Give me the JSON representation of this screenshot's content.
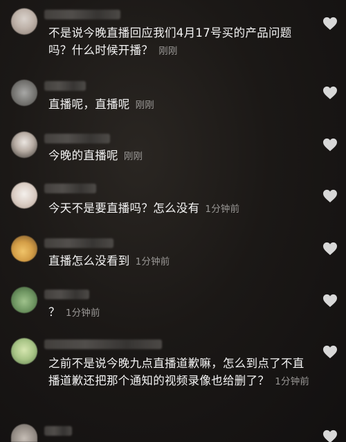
{
  "comments": [
    {
      "text": "不是说今晚直播回应我们4月17号买的产品问题吗？什么时候开播？",
      "time": "刚刚",
      "avatar_colors": [
        "#d9d2cc",
        "#8c7f76"
      ]
    },
    {
      "text": "直播呢，直播呢",
      "time": "刚刚",
      "avatar_colors": [
        "#9a9a98",
        "#55534f"
      ]
    },
    {
      "text": "今晚的直播呢",
      "time": "刚刚",
      "avatar_colors": [
        "#e8e4e0",
        "#3a3632"
      ]
    },
    {
      "text": "今天不是要直播吗？怎么没有",
      "time": "1分钟前",
      "avatar_colors": [
        "#f1ede9",
        "#c9b8ad"
      ]
    },
    {
      "text": "直播怎么没看到",
      "time": "1分钟前",
      "avatar_colors": [
        "#e7b653",
        "#a47a3a"
      ]
    },
    {
      "text": "？",
      "time": "1分钟前",
      "avatar_colors": [
        "#8fb27e",
        "#4a6b44"
      ]
    },
    {
      "text": "之前不是说今晚九点直播道歉嘛，怎么到点了不直播道歉还把那个通知的视频录像也给删了？",
      "time": "1分钟前",
      "avatar_colors": [
        "#cfe0a6",
        "#6f8f5a"
      ]
    },
    {
      "text": "",
      "time": "",
      "avatar_colors": [
        "#bfb7b0",
        "#7a746e"
      ]
    }
  ],
  "icons": {
    "like": "heart-outline-icon"
  },
  "colors": {
    "background": "#1b1816",
    "text": "#f4f4f4",
    "timestamp": "#9a9896",
    "heart": "#d8d8d8"
  }
}
